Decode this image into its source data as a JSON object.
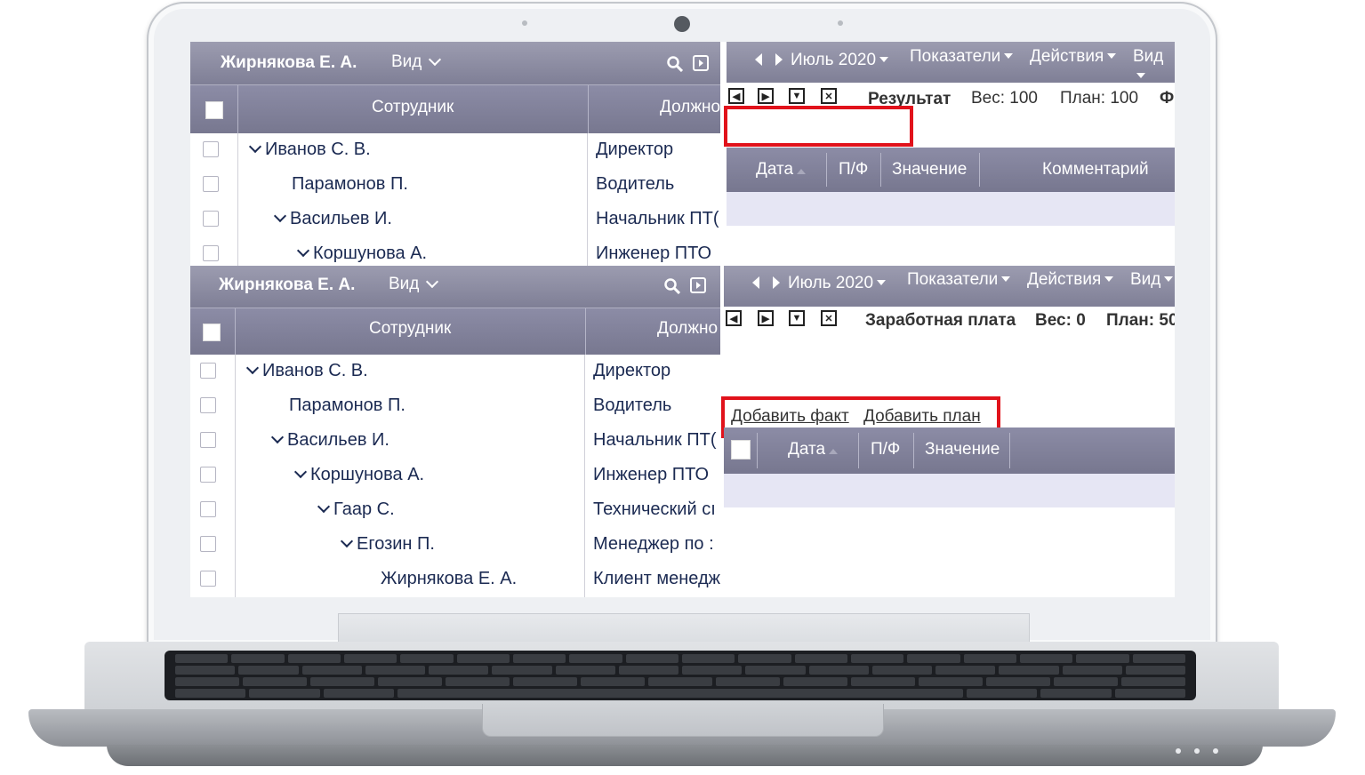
{
  "top": {
    "left": {
      "user": "Жирнякова Е. А.",
      "view_label": "Вид",
      "columns": [
        "Сотрудник",
        "Должно"
      ],
      "rows": [
        {
          "name": "Иванов С. В.",
          "position": "Директор",
          "expanded": true
        },
        {
          "name": "Парамонов П.",
          "position": "Водитель",
          "expanded": false
        },
        {
          "name": "Васильев И.",
          "position": "Начальник ПТ(",
          "expanded": true
        },
        {
          "name": "Коршунова А.",
          "position": "Инженер ПТО",
          "expanded": true
        }
      ]
    },
    "right": {
      "month": "Июль 2020",
      "menus": [
        "Показатели",
        "Действия",
        "Вид"
      ],
      "indicator": "Результат",
      "weight": "Вес: 100",
      "plan": "План: 100",
      "extra": "Ф",
      "columns": [
        "Дата",
        "П/Ф",
        "Значение",
        "Комментарий"
      ]
    }
  },
  "bottom": {
    "left": {
      "user": "Жирнякова Е. А.",
      "view_label": "Вид",
      "columns": [
        "Сотрудник",
        "Должно"
      ],
      "rows": [
        {
          "name": "Иванов С. В.",
          "position": "Директор",
          "expanded": true
        },
        {
          "name": "Парамонов П.",
          "position": "Водитель",
          "expanded": false
        },
        {
          "name": "Васильев И.",
          "position": "Начальник ПТ(",
          "expanded": true
        },
        {
          "name": "Коршунова А.",
          "position": "Инженер ПТО",
          "expanded": true
        },
        {
          "name": "Гаар С.",
          "position": "Технический сı",
          "expanded": true
        },
        {
          "name": "Егозин П.",
          "position": "Менеджер по :",
          "expanded": true
        },
        {
          "name": "Жирнякова Е. А.",
          "position": "Клиент менедж",
          "expanded": false
        }
      ]
    },
    "right": {
      "month": "Июль 2020",
      "menus": [
        "Показатели",
        "Действия",
        "Вид"
      ],
      "indicator": "Заработная плата",
      "weight": "Вес: 0",
      "plan": "План: 50",
      "add_fact": "Добавить факт",
      "add_plan": "Добавить план",
      "columns": [
        "Дата",
        "П/Ф",
        "Значение"
      ]
    }
  },
  "colors": {
    "header": "#8a8aa2",
    "row_text": "#1b2a52",
    "highlight": "#e1121b",
    "lavender": "#e6e6f4"
  },
  "icons": [
    "search-icon",
    "export-icon",
    "chevron-down-icon",
    "prev-icon",
    "next-icon",
    "filter-icon",
    "close-icon"
  ]
}
